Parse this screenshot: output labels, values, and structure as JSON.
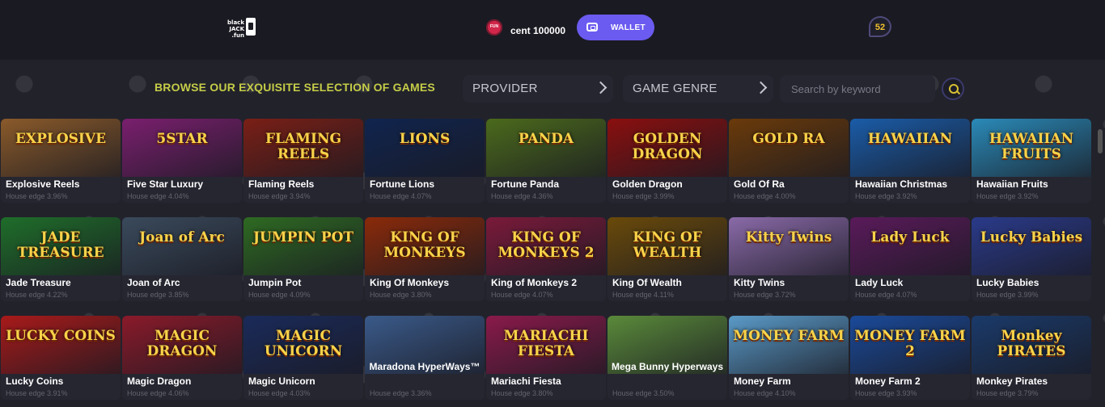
{
  "header": {
    "logo_alt": "blackjack.fun",
    "currency_badge": "FUN",
    "balance": "cent 100000",
    "wallet_label": "WALLET",
    "notification_count": "52"
  },
  "browse": {
    "title": "BROWSE OUR EXQUISITE SELECTION OF GAMES",
    "provider_label": "PROVIDER",
    "genre_label": "GAME GENRE",
    "search_placeholder": "Search by keyword"
  },
  "colors": {
    "accent": "#6b5bf0",
    "title": "#c5cd47",
    "badge": "#f3c32c"
  },
  "games": [
    {
      "name": "Explosive Reels",
      "edge": "House edge 3.96%",
      "art": "EXPLOSIVE",
      "bg": "#8a5a2a"
    },
    {
      "name": "Five Star Luxury",
      "edge": "House edge 4.04%",
      "art": "5STAR",
      "bg": "#7a1f6e"
    },
    {
      "name": "Flaming Reels",
      "edge": "House edge 3.94%",
      "art": "FLAMING REELS",
      "bg": "#7a1f16"
    },
    {
      "name": "Fortune Lions",
      "edge": "House edge 4.07%",
      "art": "LIONS",
      "bg": "#10244e"
    },
    {
      "name": "Fortune Panda",
      "edge": "House edge 4.36%",
      "art": "PANDA",
      "bg": "#4b6a1c"
    },
    {
      "name": "Golden Dragon",
      "edge": "House edge 3.99%",
      "art": "GOLDEN DRAGON",
      "bg": "#8a0f0f"
    },
    {
      "name": "Gold Of Ra",
      "edge": "House edge 4.00%",
      "art": "GOLD RA",
      "bg": "#6a3a0a"
    },
    {
      "name": "Hawaiian Christmas",
      "edge": "House edge 3.92%",
      "art": "HAWAIIAN",
      "bg": "#1a5ca8"
    },
    {
      "name": "Hawaiian Fruits",
      "edge": "House edge 3.92%",
      "art": "HAWAIIAN FRUITS",
      "bg": "#2a8ab8"
    },
    {
      "name": "Jade Treasure",
      "edge": "House edge 4.22%",
      "art": "JADE TREASURE",
      "bg": "#1f6e2a"
    },
    {
      "name": "Joan of Arc",
      "edge": "House edge 3.85%",
      "art": "Joan of Arc",
      "bg": "#3a4a5c"
    },
    {
      "name": "Jumpin Pot",
      "edge": "House edge 4.09%",
      "art": "JUMPIN POT",
      "bg": "#2e6a22"
    },
    {
      "name": "King Of Monkeys",
      "edge": "House edge 3.80%",
      "art": "KING OF MONKEYS",
      "bg": "#8a2a0a"
    },
    {
      "name": "King of Monkeys 2",
      "edge": "House edge 4.07%",
      "art": "KING OF MONKEYS 2",
      "bg": "#7a1a3a"
    },
    {
      "name": "King Of Wealth",
      "edge": "House edge 4.11%",
      "art": "KING OF WEALTH",
      "bg": "#6a4a0a"
    },
    {
      "name": "Kitty Twins",
      "edge": "House edge 3.72%",
      "art": "Kitty Twins",
      "bg": "#8a6aa8"
    },
    {
      "name": "Lady Luck",
      "edge": "House edge 4.07%",
      "art": "Lady Luck",
      "bg": "#5a1a5a"
    },
    {
      "name": "Lucky Babies",
      "edge": "House edge 3.99%",
      "art": "Lucky Babies",
      "bg": "#2a3a8a"
    },
    {
      "name": "Lucky Coins",
      "edge": "House edge 3.91%",
      "art": "LUCKY COINS",
      "bg": "#a81a1a"
    },
    {
      "name": "Magic Dragon",
      "edge": "House edge 4.06%",
      "art": "MAGIC DRAGON",
      "bg": "#8a1a2a"
    },
    {
      "name": "Magic Unicorn",
      "edge": "House edge 4.03%",
      "art": "MAGIC UNICORN",
      "bg": "#1a2a5a"
    },
    {
      "name": "Maradona HyperWays™",
      "edge": "House edge 3.36%",
      "art": "",
      "bg": "#3a5a8a",
      "overlay": true
    },
    {
      "name": "Mariachi Fiesta",
      "edge": "House edge 3.80%",
      "art": "MARIACHI FIESTA",
      "bg": "#8a1a4a"
    },
    {
      "name": "Mega Bunny Hyperways",
      "edge": "House edge 3.50%",
      "art": "",
      "bg": "#5a8a3a",
      "overlay": true
    },
    {
      "name": "Money Farm",
      "edge": "House edge 4.10%",
      "art": "MONEY FARM",
      "bg": "#5a9ac8"
    },
    {
      "name": "Money Farm 2",
      "edge": "House edge 3.93%",
      "art": "MONEY FARM 2",
      "bg": "#1a4a9a"
    },
    {
      "name": "Monkey Pirates",
      "edge": "House edge 3.79%",
      "art": "Monkey PIRATES",
      "bg": "#1a3a6a"
    }
  ]
}
